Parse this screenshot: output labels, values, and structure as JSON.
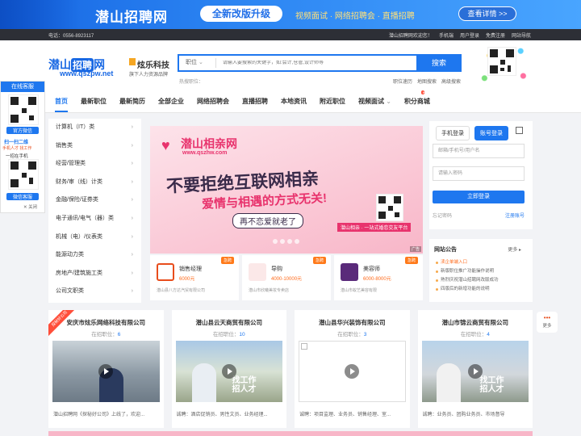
{
  "banner": {
    "brand": "潜山招聘网",
    "pill": "全新改版升级",
    "tagline": "视频面试 · 网络招聘会 · 直播招聘",
    "button": "查看详情 >>"
  },
  "topbar": {
    "phone": "电话：0556-8923117",
    "welcome": "潜山招聘网欢迎您！",
    "links": [
      "手机端",
      "用户登录",
      "免费注册",
      "网站导航"
    ]
  },
  "logo": {
    "main": "潜山",
    "badge": "招聘",
    "suffix": "网",
    "url": "www.qszpw.net",
    "partner": "炫乐科技",
    "partner_sub": "旗下人力资源品牌"
  },
  "search": {
    "category": "职位",
    "placeholder": "请输入要搜索的关键字，如:会计,仓管,设计师等",
    "button": "搜索",
    "hot_label": "热搜职位：",
    "links": [
      "职位速历",
      "地图搜索",
      "高级搜索"
    ]
  },
  "nav": {
    "items": [
      "首页",
      "最新职位",
      "最新简历",
      "全部企业",
      "网络招聘会",
      "直播招聘",
      "本地资讯",
      "附近职位",
      "视频面试",
      "积分商城"
    ],
    "hot_tag": "HOT"
  },
  "categories": [
    "计算机（IT）类",
    "销售类",
    "经营/管理类",
    "财务/审（线）计类",
    "金融/保险/证券类",
    "电子通讯/电气（器）类",
    "机械（电）/仪表类",
    "能源动力类",
    "房地产/建筑施工类",
    "公司文职类"
  ],
  "slide": {
    "site": "潜山相亲网",
    "site_url": "www.qszhw.com",
    "line1": "不要拒绝互联网相亲",
    "line2": "爱情与相遇的方式无关!",
    "line3": "再不恋爱就老了",
    "line4": "潜山相亲 · 一站式婚恋交友平台",
    "ad": "广告"
  },
  "jobs": [
    {
      "title": "销售经理",
      "salary": "6000元",
      "company": "潜山县八方达汽贸有限公司",
      "tag": "急聘"
    },
    {
      "title": "导购",
      "salary": "4000-10000元",
      "company": "潜山市欣曦美妆专卖店",
      "tag": "急聘"
    },
    {
      "title": "美容师",
      "salary": "6000-8000元",
      "company": "潜山市蚁艺美容有限",
      "tag": "急聘"
    }
  ],
  "login": {
    "tab1": "手机登录",
    "tab2": "账号登录",
    "user_placeholder": "邮箱/手机号/用户名",
    "pass_placeholder": "请输入密码",
    "button": "立即登录",
    "forgot": "忘记密码",
    "register": "注册账号"
  },
  "notice": {
    "title": "网站公告",
    "more": "更多 ▸",
    "items": [
      "渎企单端入口",
      "新版职位推广功能操作说明",
      "熟烈庆祝潜山招聘网改版成功",
      "四版后的新增功能的说明"
    ]
  },
  "companies": [
    {
      "name": "安庆市炫乐网络科技有限公司",
      "pos_label": "在招职位：",
      "count": "6",
      "desc": "潜山招聘网《探秘好公司》上线了，欢迎...",
      "ribbon": "探秘好公司"
    },
    {
      "name": "潜山县云天商贸有限公司",
      "pos_label": "在招职位：",
      "count": "10",
      "desc": "诚聘：酒店促销员、男性文员、业务经理..."
    },
    {
      "name": "潜山县华兴装饰有限公司",
      "pos_label": "在招职位：",
      "count": "3",
      "desc": "诚聘：项目监理、业务员、销售经理、室..."
    },
    {
      "name": "潜山市锦云商贸有限公司",
      "pos_label": "在招职位：",
      "count": "4",
      "desc": "诚聘：业务员、团购业务员、市场督导"
    }
  ],
  "company_video_caption": "找工作\n招人才",
  "service": {
    "title": "在线客服",
    "wechat_label": "官方微信",
    "scan_label": "扫一扫二维",
    "line": "手机人才 找工作",
    "app_label": "一招在手机",
    "kefu": "微信客服",
    "close": "✕ 关闭"
  },
  "more_side": "更多"
}
